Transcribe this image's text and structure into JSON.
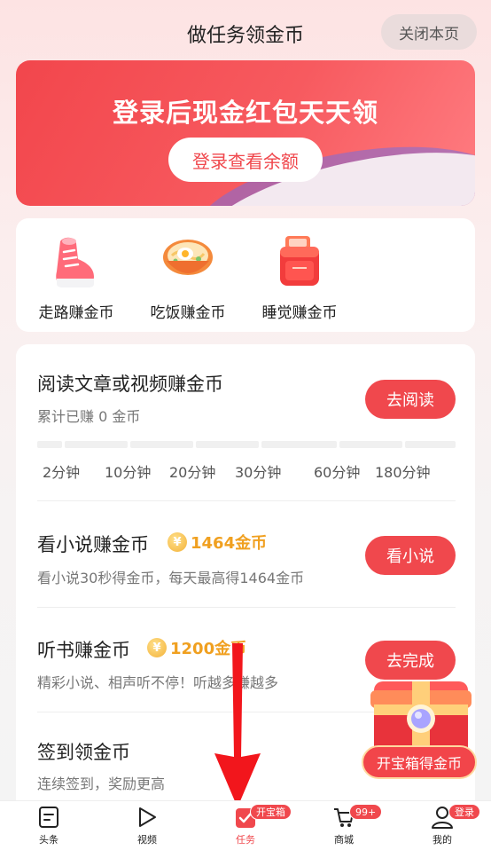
{
  "header": {
    "title": "做任务领金币",
    "close_label": "关闭本页"
  },
  "banner": {
    "title": "登录后现金红包天天领",
    "button_label": "登录查看余额"
  },
  "mini_tasks": [
    {
      "label": "走路赚金币",
      "icon": "sneaker-icon"
    },
    {
      "label": "吃饭赚金币",
      "icon": "noodle-bowl-icon"
    },
    {
      "label": "睡觉赚金币",
      "icon": "sleep-box-icon"
    }
  ],
  "tasks": {
    "read": {
      "title": "阅读文章或视频赚金币",
      "subtitle": "累计已赚 0 金币",
      "button": "去阅读",
      "ticks": [
        "2分钟",
        "10分钟",
        "20分钟",
        "30分钟",
        "60分钟",
        "180分钟"
      ],
      "progress": 0
    },
    "novel": {
      "title": "看小说赚金币",
      "reward": "1464金币",
      "subtitle": "看小说30秒得金币，每天最高得1464金币",
      "button": "看小说"
    },
    "audio": {
      "title": "听书赚金币",
      "reward": "1200金币",
      "subtitle": "精彩小说、相声听不停！听越多赚越多",
      "button": "去完成"
    },
    "signin": {
      "title": "签到领金币",
      "subtitle": "连续签到，奖励更高"
    }
  },
  "coin_symbol": "¥",
  "treasure": {
    "label": "开宝箱得金币"
  },
  "tabbar": [
    {
      "label": "头条",
      "icon": "news-icon"
    },
    {
      "label": "视频",
      "icon": "play-icon"
    },
    {
      "label": "任务",
      "icon": "task-check-icon",
      "badge": "开宝箱",
      "active": true
    },
    {
      "label": "商城",
      "icon": "cart-icon",
      "badge": "99+"
    },
    {
      "label": "我的",
      "icon": "user-icon",
      "badge": "登录"
    }
  ],
  "colors": {
    "accent": "#f0484d",
    "coin": "#f0a020"
  }
}
